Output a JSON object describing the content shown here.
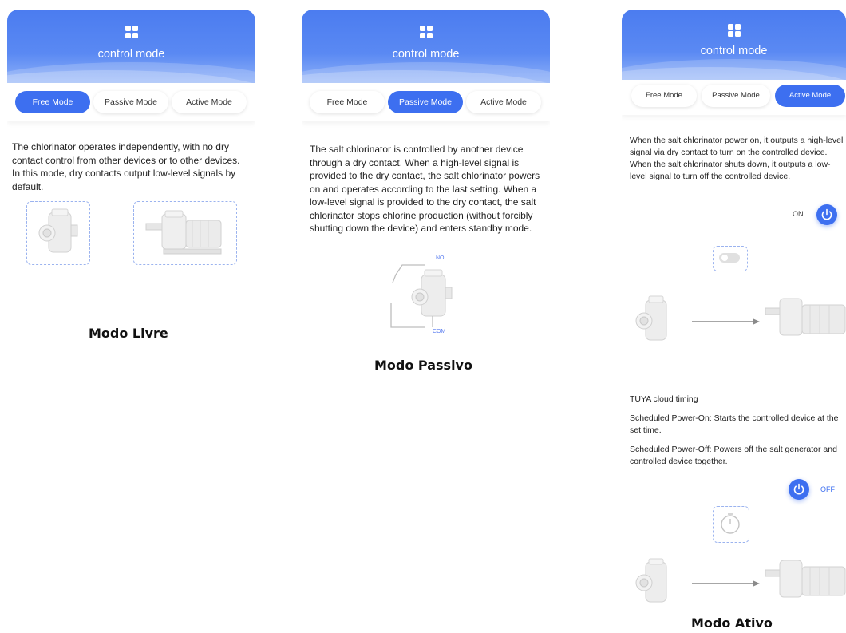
{
  "colors": {
    "accent": "#3d6ff0",
    "header": "#5a89f3",
    "dashed": "#9bb3ef",
    "off_label": "#3d6ff0"
  },
  "panels": [
    {
      "title": "control mode",
      "tabs": [
        "Free Mode",
        "Passive Mode",
        "Active Mode"
      ],
      "active_tab": "Free Mode",
      "description": "The chlorinator operates independently, with no dry contact control from other devices or to other devices. In this mode, dry contacts output low-level signals by default.",
      "caption": "Modo Livre"
    },
    {
      "title": "control mode",
      "tabs": [
        "Free Mode",
        "Passive Mode",
        "Active Mode"
      ],
      "active_tab": "Passive Mode",
      "description": "The salt chlorinator is controlled by another device through a dry contact. When a high-level signal is provided to the dry contact,  the salt chlorinator powers on and operates according to the last setting. When a low-level signal is provided to the dry contact,  the salt chlorinator stops chlorine production (without forcibly shutting down the device) and enters standby mode.",
      "diagram_no_label": "NO",
      "diagram_com_label": "COM",
      "caption": "Modo Passivo"
    },
    {
      "title": "control mode",
      "tabs": [
        "Free Mode",
        "Passive Mode",
        "Active Mode"
      ],
      "active_tab": "Active Mode",
      "description": "When the salt chlorinator power on, it outputs a high-level signal via dry contact to turn on the controlled device.  When the salt chlorinator shuts down, it outputs a low-level signal to turn off the controlled device.",
      "power_on_label": "ON",
      "cloud_title": "TUYA cloud timing",
      "scheduled_on": "Scheduled Power-On: Starts the controlled device at the set time.",
      "scheduled_off": "Scheduled Power-Off: Powers off the salt generator and controlled device together.",
      "power_off_label": "OFF",
      "caption": "Modo Ativo"
    }
  ],
  "icons": {
    "header": "grid-icon",
    "power": "power-icon",
    "toggle": "toggle-icon",
    "timer": "timer-icon",
    "arrow": "arrow-right-icon",
    "chlorinator": "chlorinator-device-icon",
    "pump": "pump-device-icon"
  }
}
